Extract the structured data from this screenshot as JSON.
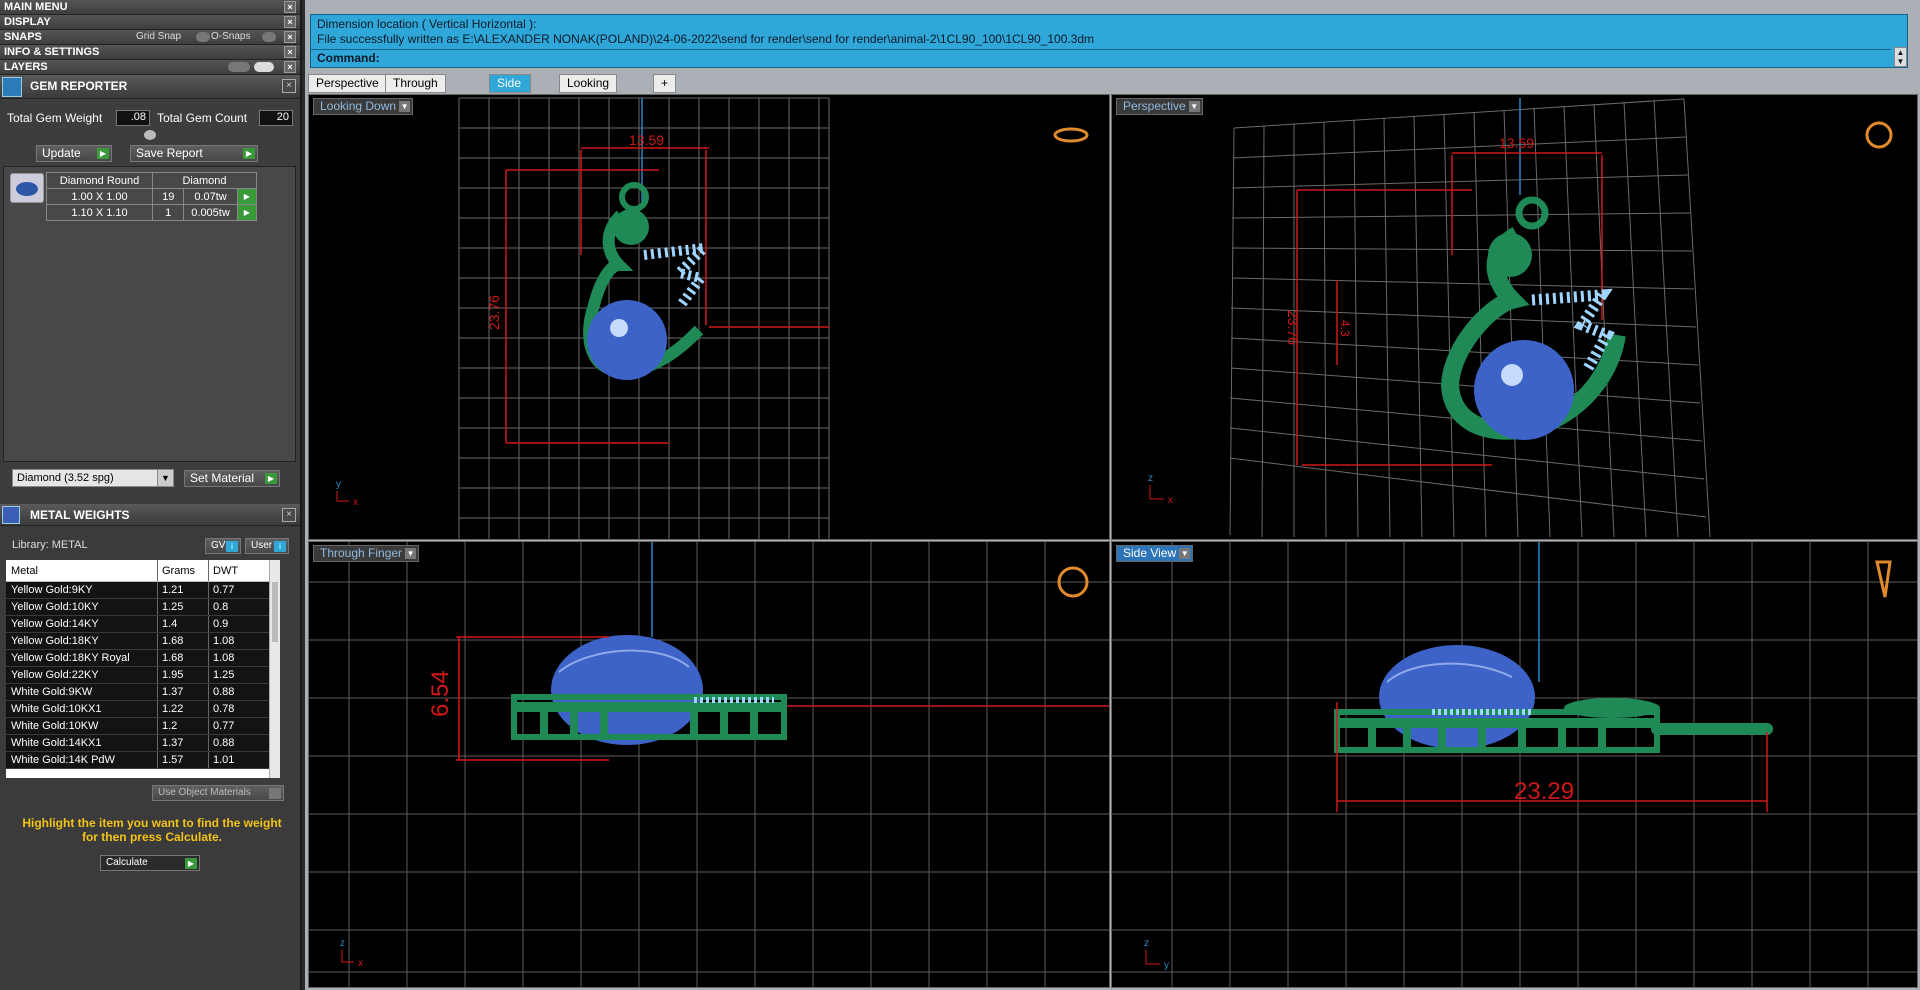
{
  "menu": [
    {
      "label": "MAIN MENU"
    },
    {
      "label": "DISPLAY"
    },
    {
      "label": "SNAPS"
    },
    {
      "label": "INFO & SETTINGS"
    },
    {
      "label": "LAYERS"
    }
  ],
  "snaps": {
    "grid_snap": "Grid Snap",
    "o_snaps": "O-Snaps"
  },
  "gem_reporter": {
    "title": "GEM REPORTER",
    "total_weight_label": "Total Gem Weight",
    "total_weight": ".08",
    "total_count_label": "Total Gem Count",
    "total_count": "20",
    "update": "Update",
    "save_report": "Save Report",
    "gem_shape": "Diamond Round",
    "gem_type": "Diamond",
    "rows": [
      {
        "size": "1.00 X 1.00",
        "count": "19",
        "weight": "0.07tw"
      },
      {
        "size": "1.10 X 1.10",
        "count": "1",
        "weight": "0.005tw"
      }
    ],
    "material_select": "Diamond     (3.52 spg)",
    "set_material": "Set Material"
  },
  "metal_weights": {
    "title": "METAL WEIGHTS",
    "library": "Library: METAL",
    "gv": "GV",
    "user": "User",
    "headers": [
      "Metal",
      "Grams",
      "DWT"
    ],
    "rows": [
      [
        "Yellow Gold:9KY",
        "1.21",
        "0.77"
      ],
      [
        "Yellow Gold:10KY",
        "1.25",
        "0.8"
      ],
      [
        "Yellow Gold:14KY",
        "1.4",
        "0.9"
      ],
      [
        "Yellow Gold:18KY",
        "1.68",
        "1.08"
      ],
      [
        "Yellow Gold:18KY Royal",
        "1.68",
        "1.08"
      ],
      [
        "Yellow Gold:22KY",
        "1.95",
        "1.25"
      ],
      [
        "White Gold:9KW",
        "1.37",
        "0.88"
      ],
      [
        "White Gold:10KX1",
        "1.22",
        "0.78"
      ],
      [
        "White Gold:10KW",
        "1.2",
        "0.77"
      ],
      [
        "White Gold:14KX1",
        "1.37",
        "0.88"
      ],
      [
        "White Gold:14K PdW",
        "1.57",
        "1.01"
      ]
    ],
    "use_object_materials": "Use Object Materials",
    "hint": "Highlight the item you want to find the weight for then press Calculate.",
    "calculate": "Calculate"
  },
  "command": {
    "line1": "Dimension location ( Vertical  Horizontal ):",
    "line2": "File successfully written as E:\\ALEXANDER NONAK(POLAND)\\24-06-2022\\send for render\\send for render\\animal-2\\1CL90_100\\1CL90_100.3dm",
    "prompt": "Command:"
  },
  "tabs": [
    "Perspective",
    "Through Finger",
    "Side View",
    "Looking Down",
    "+"
  ],
  "viewports": {
    "top_left": {
      "label": "Looking Down",
      "dim_w": "13.59",
      "dim_h": "23.76",
      "axis_a": "y",
      "axis_b": "x"
    },
    "top_right": {
      "label": "Perspective",
      "dim_w": "13.59",
      "dim_h": "23.76",
      "dim_small": "4.3",
      "axis_a": "z",
      "axis_b": "x"
    },
    "bottom_left": {
      "label": "Through Finger",
      "dim": "6.54",
      "axis_a": "z",
      "axis_b": "x"
    },
    "bottom_right": {
      "label": "Side View",
      "dim": "23.29",
      "axis_a": "z",
      "axis_b": "y"
    }
  },
  "colors": {
    "accent": "#2fa7d8",
    "dimension": "#e01818",
    "metal": "#1f8a55",
    "pearl": "#3d63c8",
    "gem": "#9fd4ff"
  }
}
